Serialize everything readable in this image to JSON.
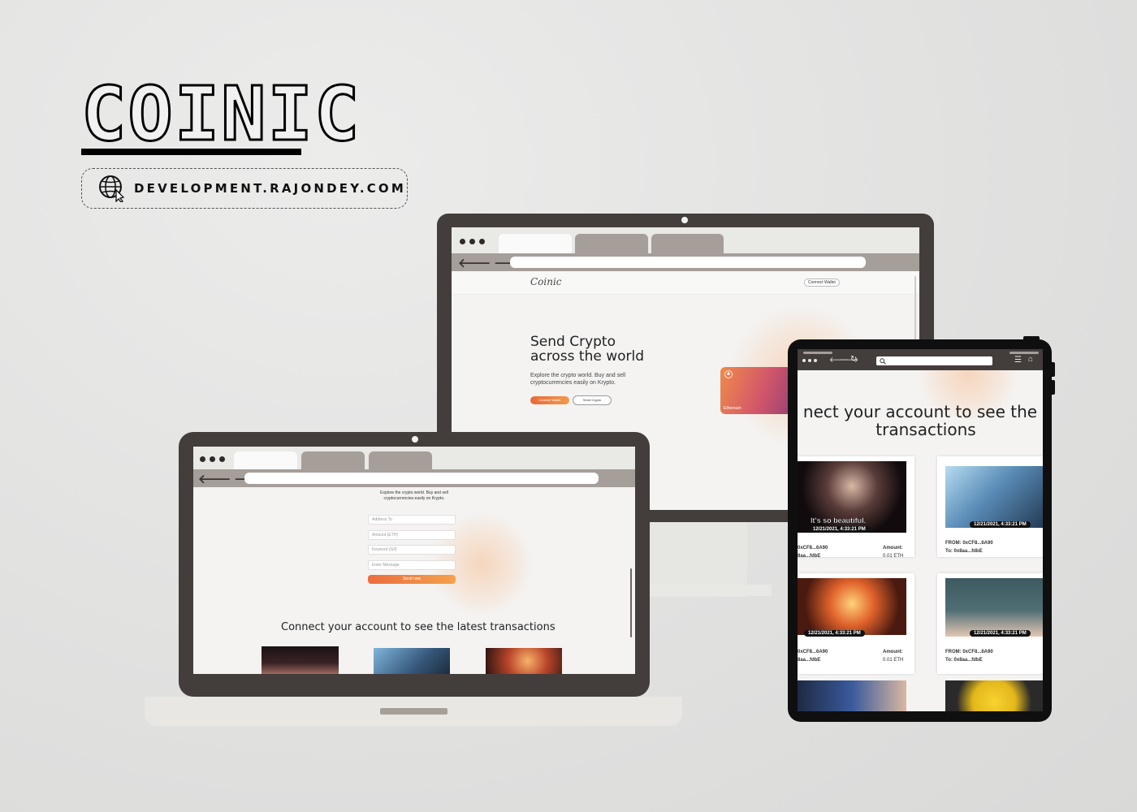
{
  "brand": {
    "name": "COINIC",
    "url": "DEVELOPMENT.RAJONDEY.COM"
  },
  "icons": {
    "globe": "globe-cursor-icon",
    "back": "arrow-left-icon",
    "forward": "arrow-right-icon",
    "reload": "reload-icon",
    "search": "search-icon",
    "menu": "hamburger-icon",
    "home": "home-icon"
  },
  "monitor": {
    "site_logo": "Coinic",
    "connect_wallet": "Connect Wallet",
    "hero_line1": "Send Crypto",
    "hero_line2": "across the world",
    "hero_sub": "Explore the crypto world. Buy and sell cryptocurrencies easily on Krypto.",
    "btn_connect": "Connect Wallet",
    "btn_send": "Send Crypto",
    "card_label": "Ethereum"
  },
  "laptop": {
    "intro": "Explore the crypto world. Buy and sell cryptocurrencies easily on Krypto.",
    "placeholders": [
      "Address To",
      "Amount (ETH)",
      "Keyword (Gif)",
      "Enter Message"
    ],
    "send_btn": "Send now",
    "section_title": "Connect your account to see the latest transactions"
  },
  "tablet": {
    "title_line1": "nect your account to see the",
    "title_line2": "transactions",
    "cards": [
      {
        "timestamp": "12/21/2021, 4:33:21 PM",
        "caption": "It's so beautiful.",
        "from": "0xCF8...6A90",
        "to": "8aa...fdbE",
        "amount_label": "Amount:",
        "amount": "0.01 ETH"
      },
      {
        "timestamp": "12/21/2021, 4:33:21 PM",
        "from": "FROM: 0xCF8...6A90",
        "to": "To: 0x8aa...fdbE"
      },
      {
        "timestamp": "12/21/2021, 4:33:21 PM",
        "from": "0xCF8...6A90",
        "to": "8aa...fdbE",
        "amount_label": "Amount:",
        "amount": "0.01 ETH"
      },
      {
        "timestamp": "12/21/2021, 4:33:21 PM",
        "from": "FROM: 0xCF8...6A90",
        "to": "To: 0x8aa...fdbE"
      }
    ]
  },
  "colors": {
    "bezel": "#433d3c",
    "tab_inactive": "#a59e99",
    "accent_orange": "#ec6d3e"
  }
}
